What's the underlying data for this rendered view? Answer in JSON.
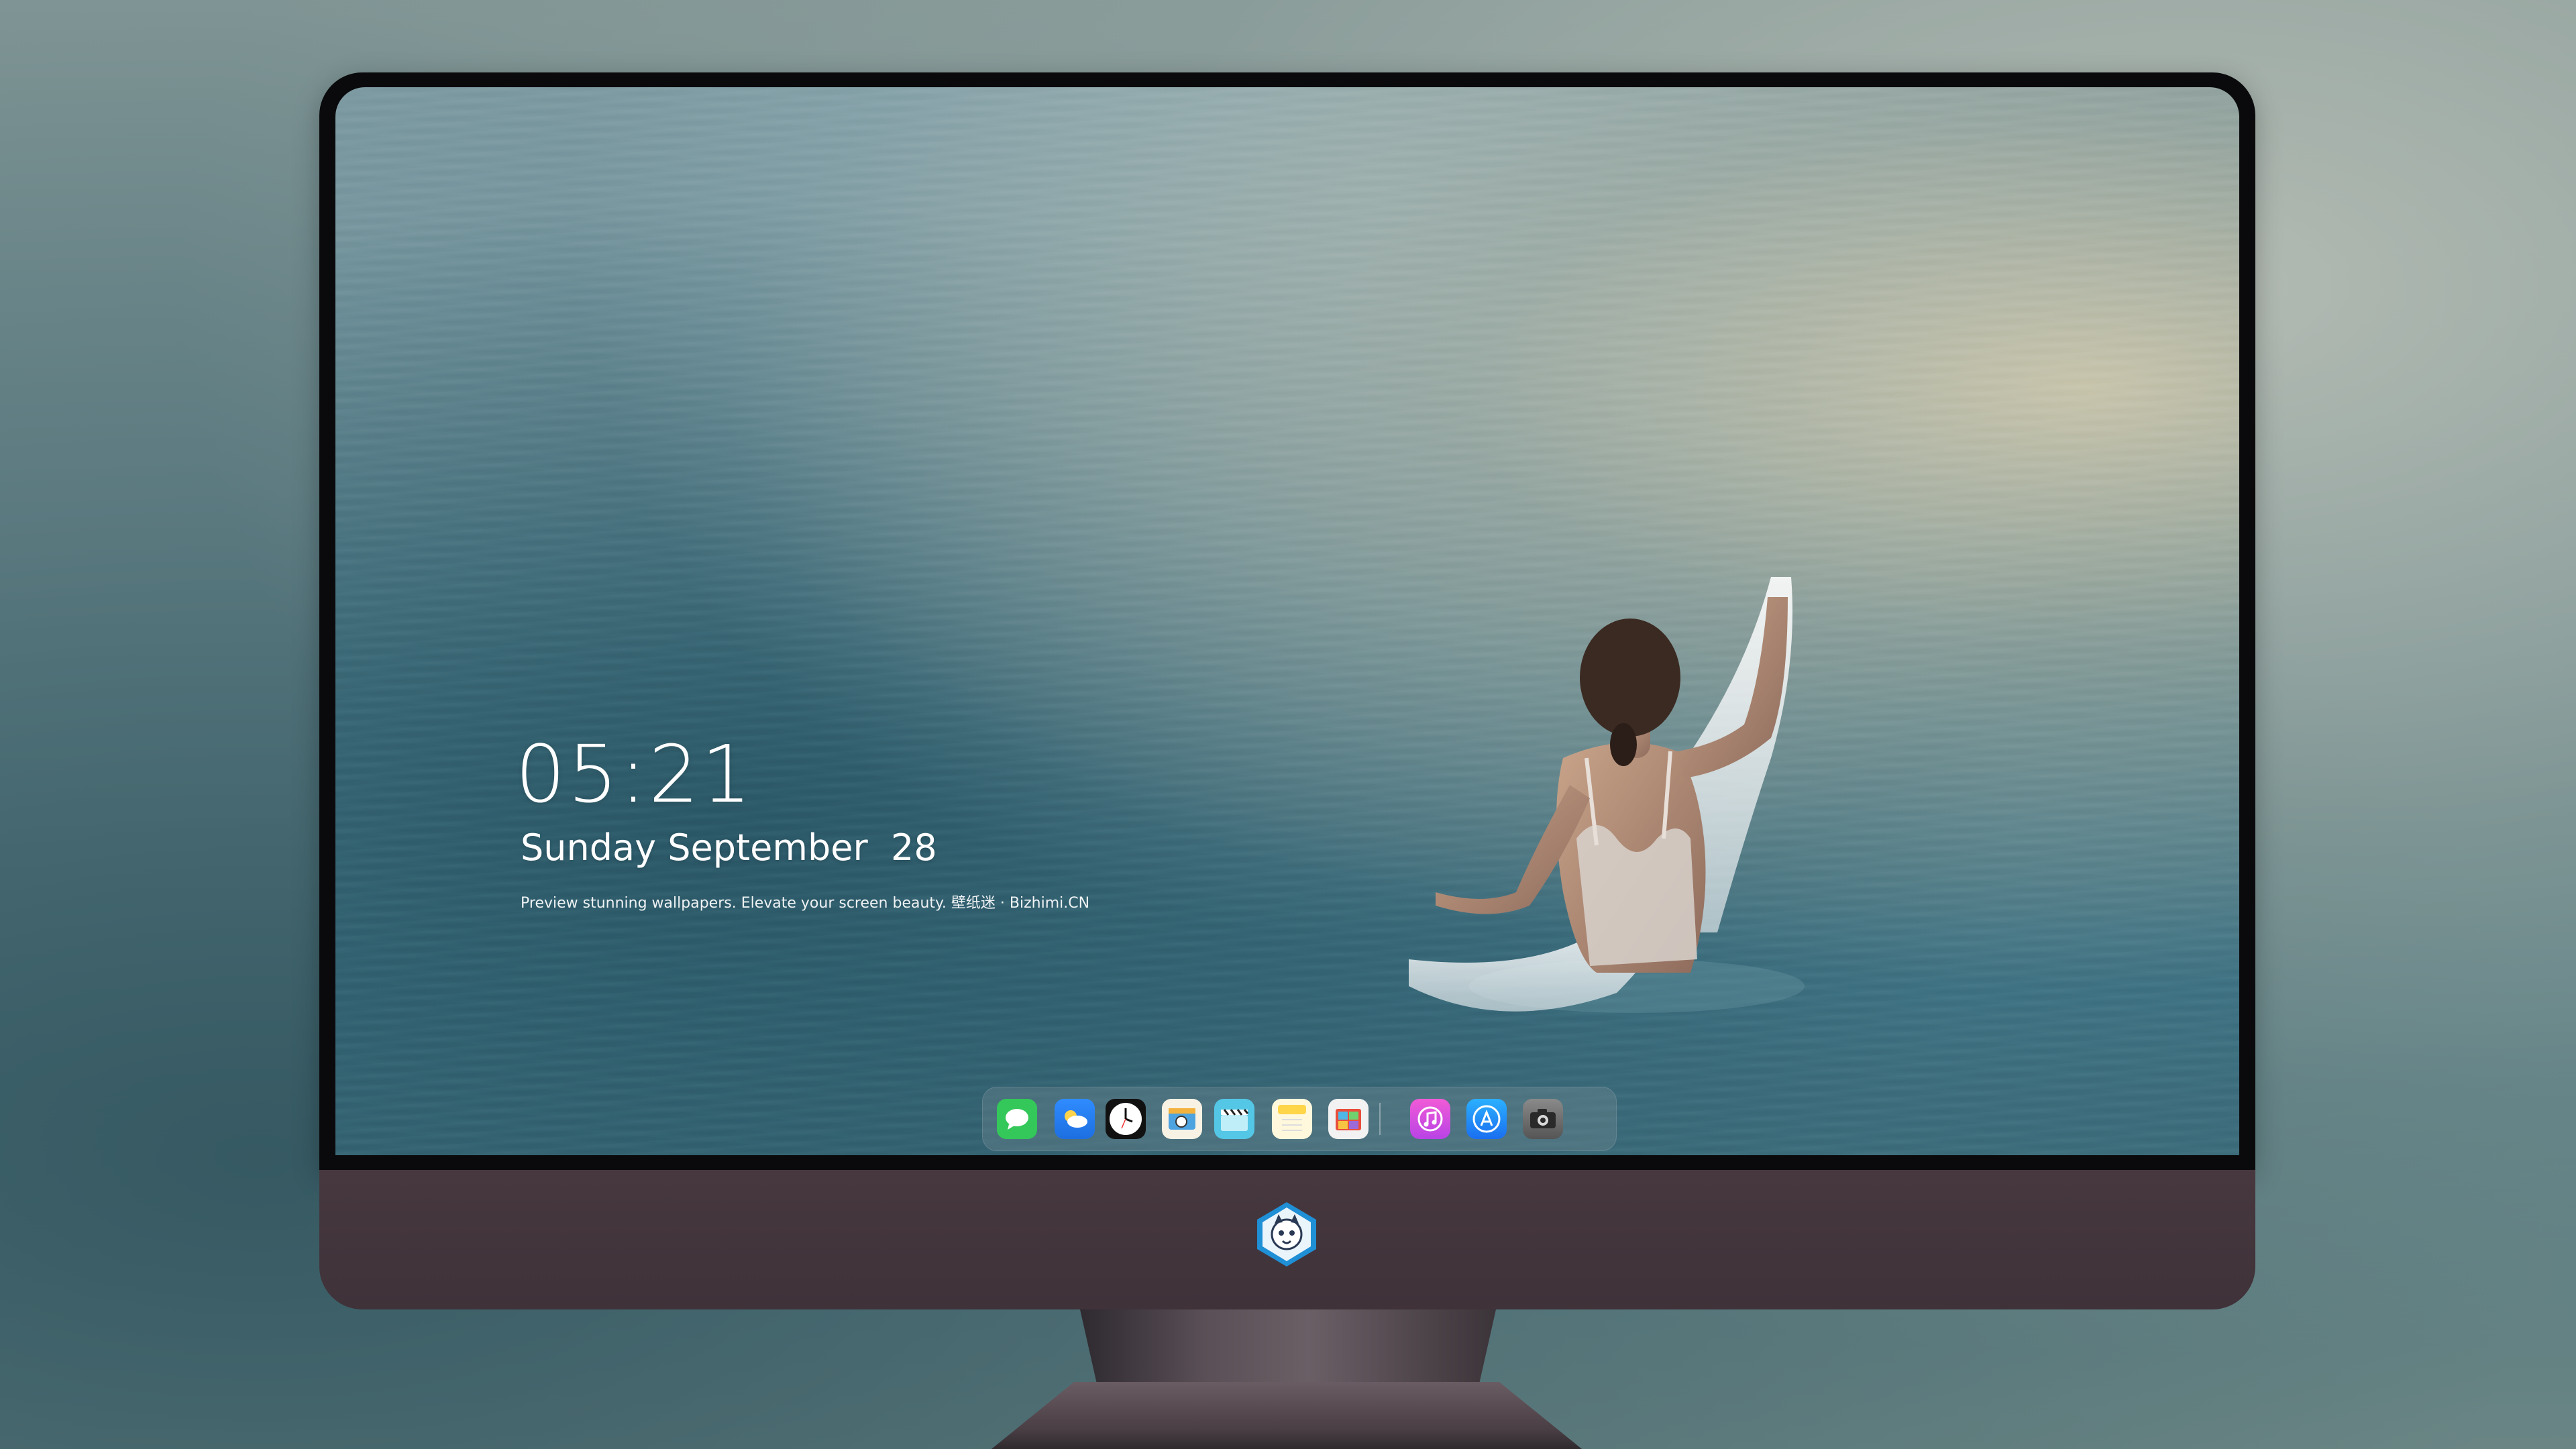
{
  "lockscreen": {
    "time": "05:21",
    "date": "Sunday September  28",
    "tagline": "Preview stunning wallpapers. Elevate your screen beauty. 壁纸迷 · Bizhimi.CN"
  },
  "dock": {
    "left_apps": [
      {
        "name": "messages",
        "icon": "messages-icon",
        "color": "#34c759"
      },
      {
        "name": "weather",
        "icon": "weather-icon",
        "color": "#1e90ff"
      },
      {
        "name": "clock",
        "icon": "clock-icon",
        "color": "#111111"
      },
      {
        "name": "preview",
        "icon": "preview-icon",
        "color": "#f3d36b"
      },
      {
        "name": "clips",
        "icon": "clapperboard-icon",
        "color": "#54c7e6"
      },
      {
        "name": "notes",
        "icon": "notes-icon",
        "color": "#ffd54a"
      },
      {
        "name": "photo-booth",
        "icon": "photo-booth-icon",
        "color": "#e94e3c"
      }
    ],
    "right_apps": [
      {
        "name": "itunes",
        "icon": "music-note-icon",
        "color": "#d653d8"
      },
      {
        "name": "app-store",
        "icon": "app-store-icon",
        "color": "#1a8cff"
      },
      {
        "name": "camera",
        "icon": "camera-icon",
        "color": "#6b6b6b"
      }
    ]
  },
  "colors": {
    "bezel": "#0a0a0c",
    "chin": "#47383f",
    "water_dark": "#3d6c7b",
    "water_light": "#d7cdaf"
  }
}
